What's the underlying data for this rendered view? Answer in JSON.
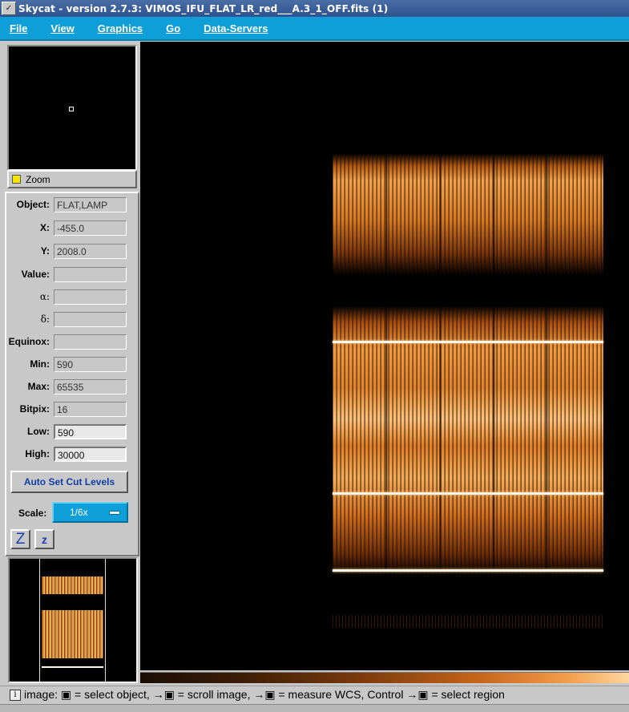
{
  "window": {
    "title": "Skycat - version 2.7.3: VIMOS_IFU_FLAT_LR_red___A.3_1_OFF.fits (1)",
    "close_glyph": "✓"
  },
  "menubar": {
    "items": [
      "File",
      "View",
      "Graphics",
      "Go",
      "Data-Servers"
    ]
  },
  "zoom": {
    "label": "Zoom"
  },
  "info": {
    "object": {
      "label": "Object:",
      "value": "FLAT,LAMP"
    },
    "x": {
      "label": "X:",
      "value": "-455.0"
    },
    "y": {
      "label": "Y:",
      "value": "2008.0"
    },
    "value": {
      "label": "Value:",
      "value": ""
    },
    "alpha": {
      "label": "α:",
      "value": ""
    },
    "delta": {
      "label": "δ:",
      "value": ""
    },
    "equinox": {
      "label": "Equinox:",
      "value": ""
    },
    "min": {
      "label": "Min:",
      "value": "590"
    },
    "max": {
      "label": "Max:",
      "value": "65535"
    },
    "bitpix": {
      "label": "Bitpix:",
      "value": "16"
    },
    "low": {
      "label": "Low:",
      "value": "590"
    },
    "high": {
      "label": "High:",
      "value": "30000"
    }
  },
  "cut_button": {
    "label": "Auto Set Cut Levels"
  },
  "scale": {
    "label": "Scale:",
    "value": "1/6x"
  },
  "zoom_buttons": {
    "zoom_in": "Z",
    "zoom_out": "z"
  },
  "statusbar": {
    "icon": "i",
    "text": "image: ▣ = select object, →▣ = scroll image, →▣ = measure WCS, Control →▣ = select region"
  }
}
